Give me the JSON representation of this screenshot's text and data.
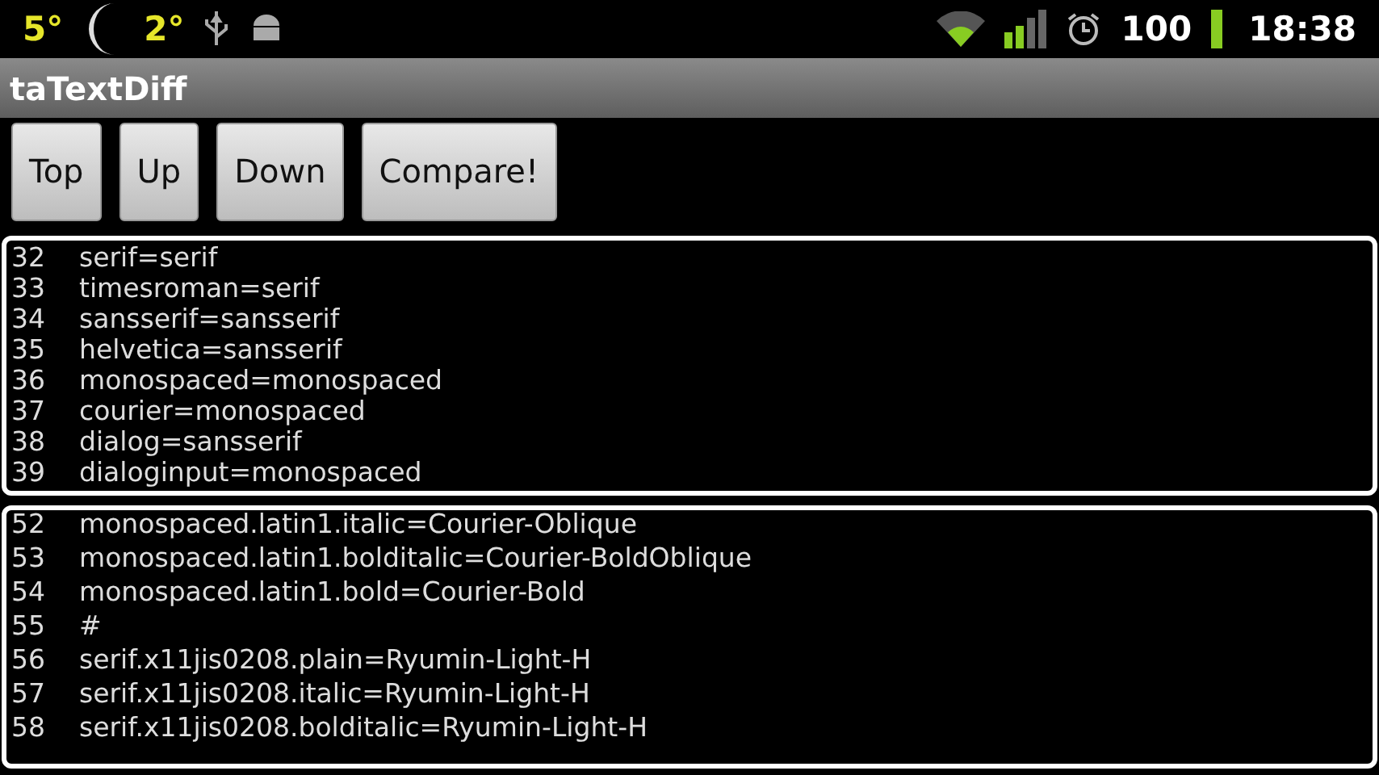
{
  "status_bar": {
    "temp_high": "5°",
    "temp_low": "2°",
    "battery": "100",
    "time": "18:38"
  },
  "title": "taTextDiff",
  "buttons": [
    "Top",
    "Up",
    "Down",
    "Compare!"
  ],
  "panels": [
    {
      "lines": [
        {
          "number": "32",
          "text": "serif=serif"
        },
        {
          "number": "33",
          "text": "timesroman=serif"
        },
        {
          "number": "34",
          "text": "sansserif=sansserif"
        },
        {
          "number": "35",
          "text": "helvetica=sansserif"
        },
        {
          "number": "36",
          "text": "monospaced=monospaced"
        },
        {
          "number": "37",
          "text": "courier=monospaced"
        },
        {
          "number": "38",
          "text": "dialog=sansserif"
        },
        {
          "number": "39",
          "text": "dialoginput=monospaced"
        }
      ]
    },
    {
      "lines": [
        {
          "number": "52",
          "text": "monospaced.latin1.italic=Courier-Oblique"
        },
        {
          "number": "53",
          "text": "monospaced.latin1.bolditalic=Courier-BoldOblique"
        },
        {
          "number": "54",
          "text": "monospaced.latin1.bold=Courier-Bold"
        },
        {
          "number": "55",
          "text": "#"
        },
        {
          "number": "56",
          "text": "serif.x11jis0208.plain=Ryumin-Light-H"
        },
        {
          "number": "57",
          "text": "serif.x11jis0208.italic=Ryumin-Light-H"
        },
        {
          "number": "58",
          "text": "serif.x11jis0208.bolditalic=Ryumin-Light-H"
        }
      ]
    }
  ]
}
